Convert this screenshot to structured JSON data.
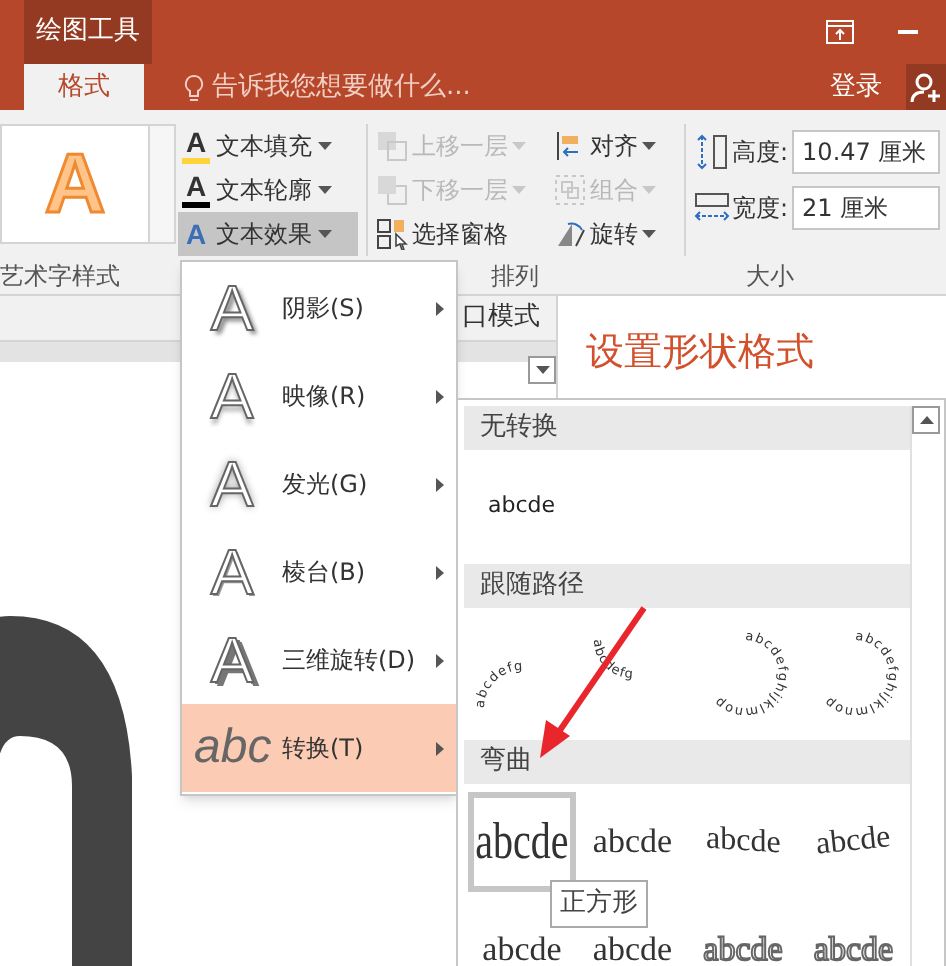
{
  "context_tab": "绘图工具",
  "tabs": [
    {
      "label": "格式",
      "selected": true
    }
  ],
  "search": {
    "placeholder": "告诉我您想要做什么..."
  },
  "sign_in": "登录",
  "ribbon": {
    "wordart_preview": "A",
    "text_buttons": [
      {
        "kind": "fill",
        "glyph": "A",
        "label": "文本填充",
        "selected": false
      },
      {
        "kind": "outline",
        "glyph": "A",
        "label": "文本轮廓",
        "selected": false
      },
      {
        "kind": "effects",
        "glyph": "A",
        "label": "文本效果",
        "selected": true
      }
    ],
    "arrange_buttons": [
      {
        "kind": "bring-forward",
        "label": "上移一层",
        "disabled": true
      },
      {
        "kind": "send-backward",
        "label": "下移一层",
        "disabled": true
      },
      {
        "kind": "selection-pane",
        "label": "选择窗格",
        "disabled": false
      },
      {
        "kind": "align",
        "label": "对齐",
        "disabled": false
      },
      {
        "kind": "group",
        "label": "组合",
        "disabled": true
      },
      {
        "kind": "rotate",
        "label": "旋转",
        "disabled": false
      }
    ],
    "size_fields": [
      {
        "kind": "height",
        "label": "高度:",
        "value": "10.47 厘米"
      },
      {
        "kind": "width",
        "label": "宽度:",
        "value": "21 厘米"
      }
    ],
    "group_labels": [
      "艺术字样式",
      "排列",
      "大小"
    ]
  },
  "pane_partial": "口模式",
  "pane_title": "设置形状格式",
  "effects_menu": [
    {
      "kind": "shadow",
      "glyph": "A",
      "label": "阴影(S)",
      "selected": false
    },
    {
      "kind": "reflection",
      "glyph": "A",
      "label": "映像(R)",
      "selected": false
    },
    {
      "kind": "glow",
      "glyph": "A",
      "label": "发光(G)",
      "selected": false
    },
    {
      "kind": "bevel",
      "glyph": "A",
      "label": "棱台(B)",
      "selected": false
    },
    {
      "kind": "rotation",
      "glyph": "A",
      "label": "三维旋转(D)",
      "selected": false
    },
    {
      "kind": "transform",
      "glyph": "abc",
      "label": "转换(T)",
      "selected": true
    }
  ],
  "transform_gallery": [
    {
      "title": "无转换",
      "items": [
        {
          "kind": "plain",
          "text": "abcde",
          "selected": false
        }
      ]
    },
    {
      "title": "跟随路径",
      "items": [
        {
          "kind": "arch-up",
          "text": "abcdefg",
          "selected": false
        },
        {
          "kind": "arch-down",
          "text": "abcdefg",
          "selected": false
        },
        {
          "kind": "circle",
          "text": "abcdefghijklmnop",
          "selected": false
        },
        {
          "kind": "button",
          "text": "abcdefghijklmnop",
          "selected": false
        }
      ]
    },
    {
      "title": "弯曲",
      "items": [
        {
          "kind": "square",
          "text": "abcde",
          "selected": true
        },
        {
          "kind": "stop",
          "text": "abcde",
          "selected": false
        },
        {
          "kind": "triangle",
          "text": "abcde",
          "selected": false
        },
        {
          "kind": "chevron",
          "text": "abcde",
          "selected": false
        },
        {
          "kind": "triangle-down",
          "text": "abcde",
          "selected": false
        },
        {
          "kind": "stop",
          "text": "abcde",
          "selected": false
        },
        {
          "kind": "ring",
          "text": "abcde",
          "selected": false
        },
        {
          "kind": "ring",
          "text": "abcde",
          "selected": false
        }
      ]
    }
  ],
  "tooltip": "正方形"
}
